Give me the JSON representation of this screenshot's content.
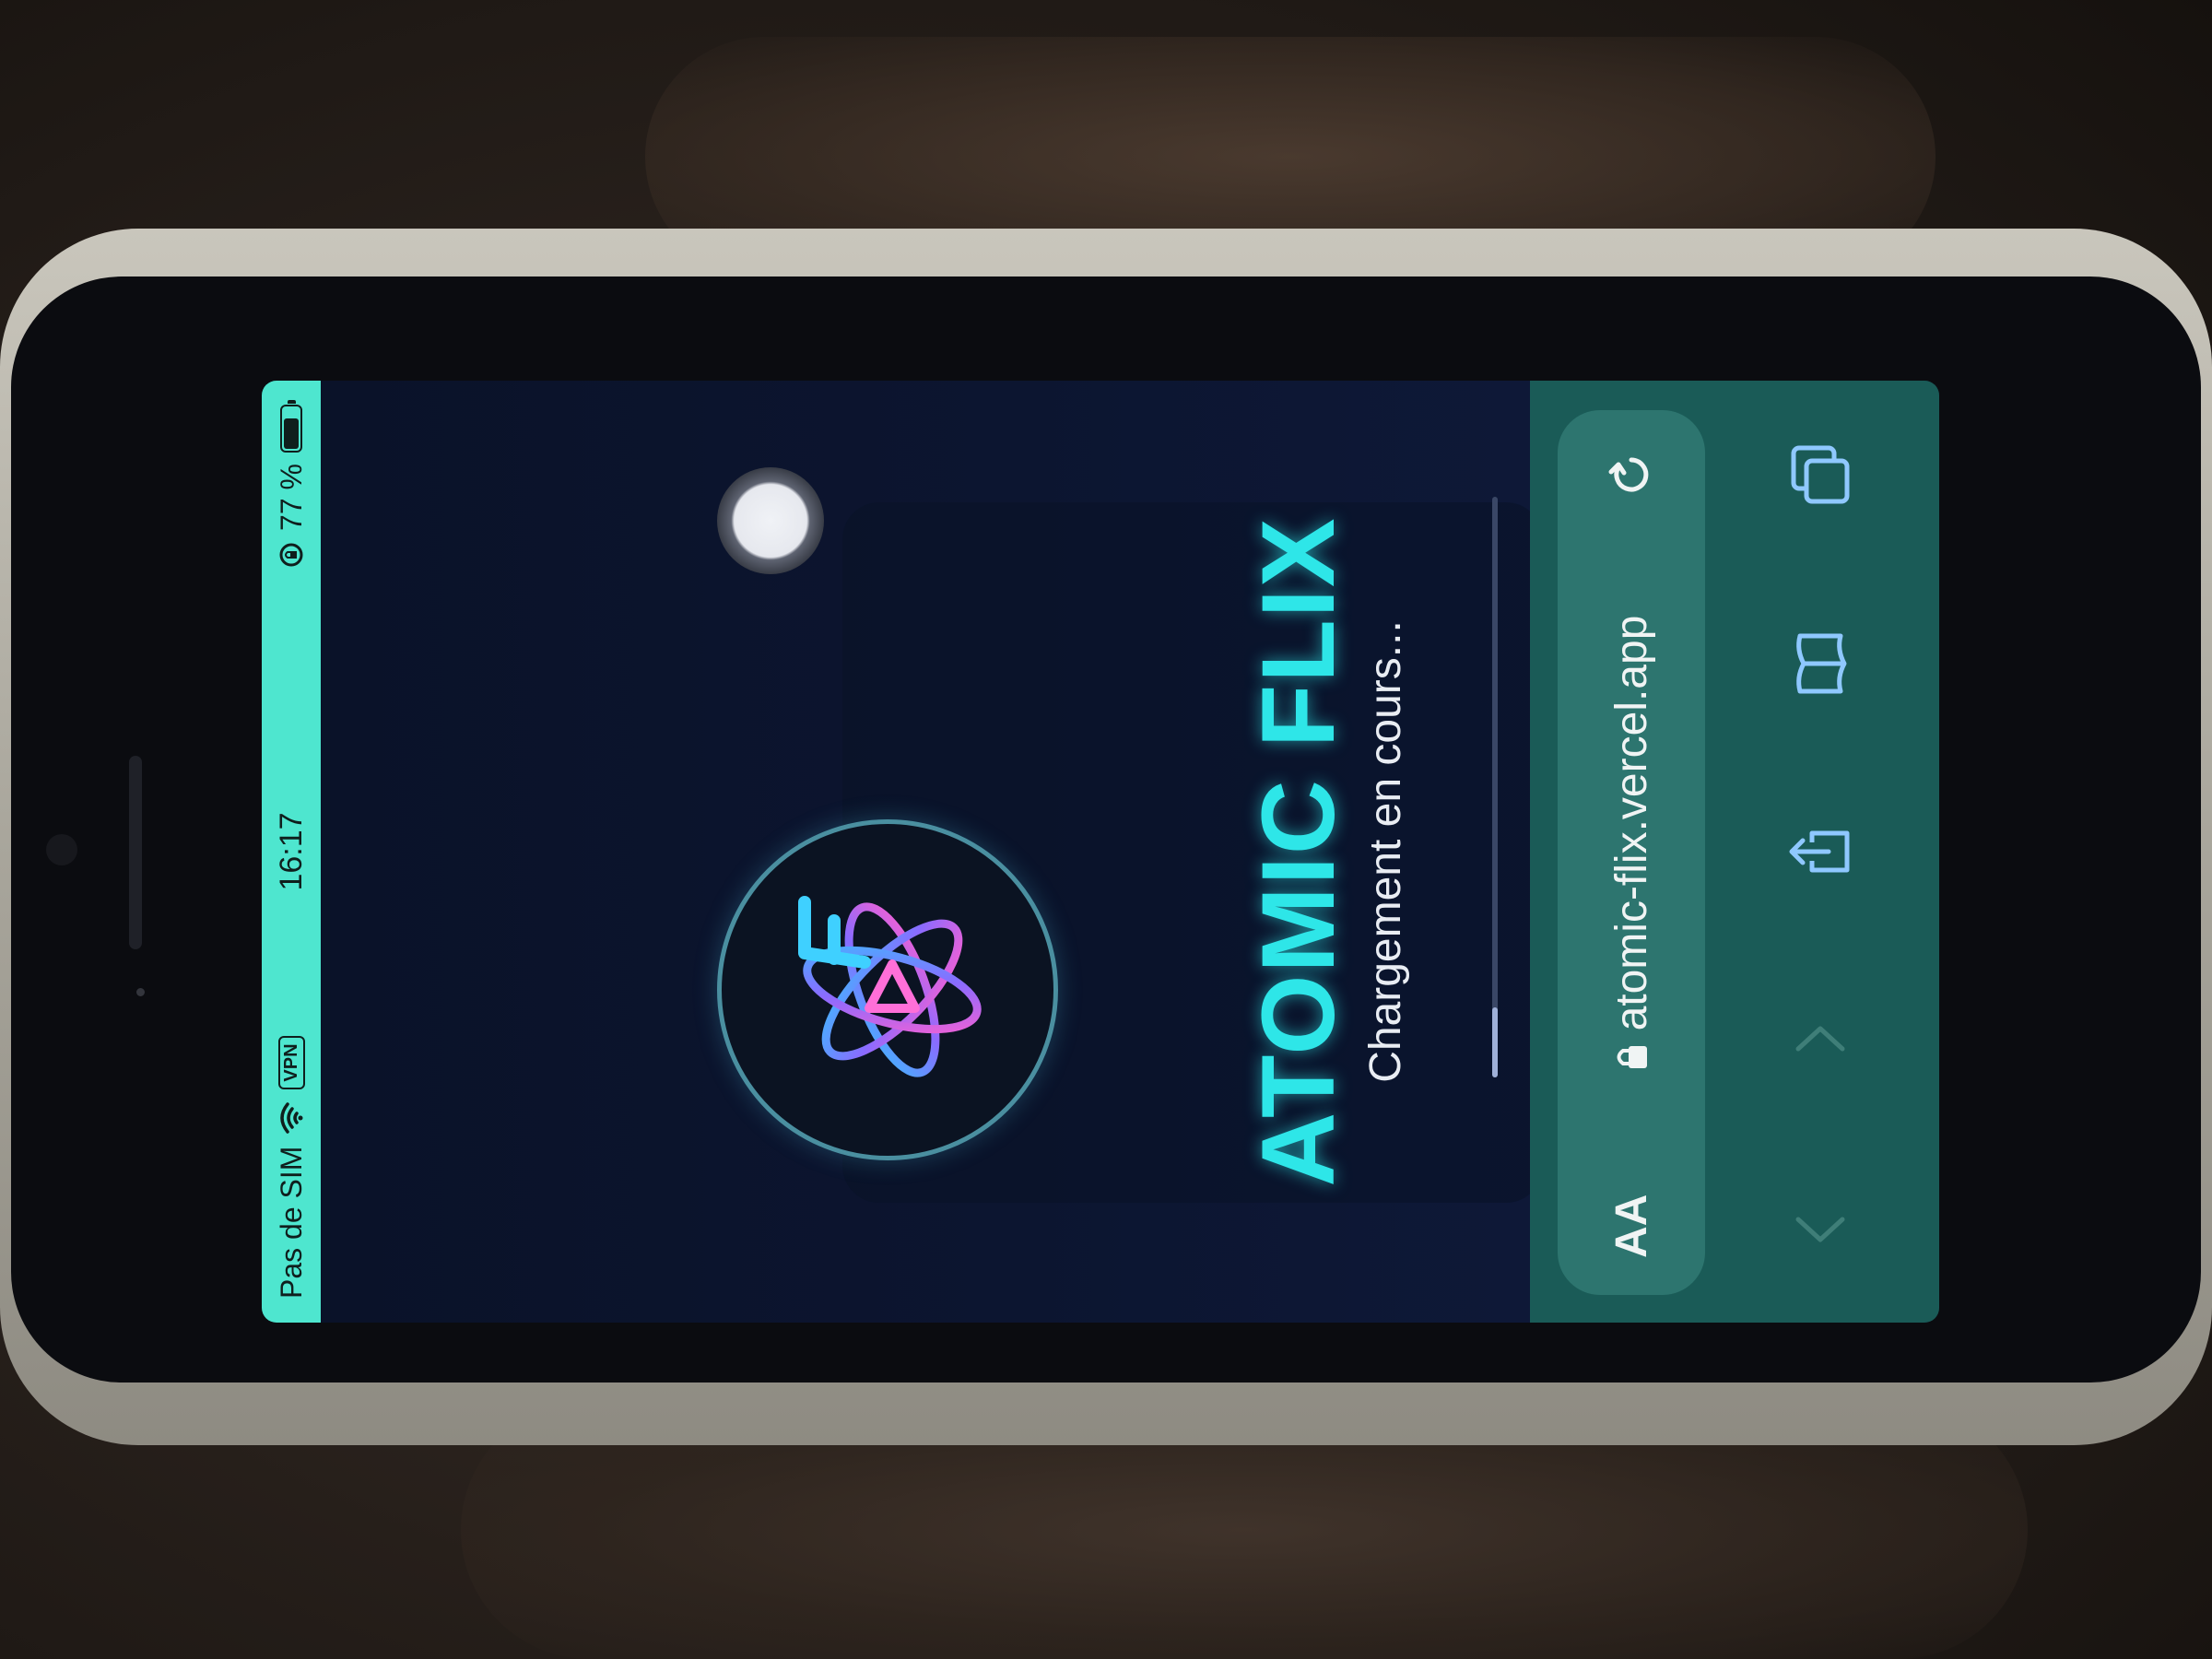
{
  "status_bar": {
    "carrier": "Pas de SIM",
    "vpn": "VPN",
    "time": "16:17",
    "battery": "77 %",
    "battery_level": 0.77
  },
  "app": {
    "title": "ATOMIC FLIX",
    "loading_text": "Chargement en cours...",
    "progress": 0.12
  },
  "browser": {
    "text_size_label": "AA",
    "url": "atomic-flix.vercel.app"
  },
  "icons": {
    "wifi": "wifi-icon",
    "orientation_lock": "orientation-lock-icon",
    "lock": "lock-icon",
    "reload": "reload-icon",
    "back": "chevron-left-icon",
    "forward": "chevron-right-icon",
    "share": "share-icon",
    "bookmarks": "bookmarks-icon",
    "tabs": "tabs-icon"
  },
  "colors": {
    "status_bar": "#4ee6cf",
    "title": "#2ee6e8",
    "background": "#0c1530",
    "browser_bar": "#1a5b57"
  }
}
